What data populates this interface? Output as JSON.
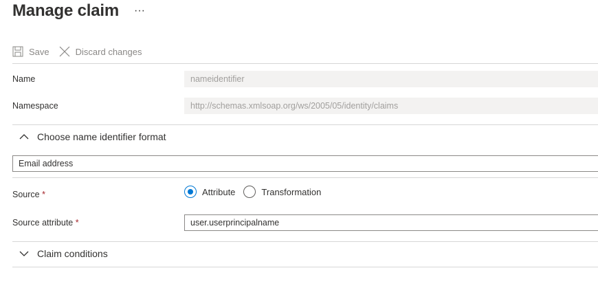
{
  "page": {
    "title": "Manage claim",
    "more": "···"
  },
  "toolbar": {
    "save_label": "Save",
    "discard_label": "Discard changes"
  },
  "form": {
    "name_label": "Name",
    "name_value": "nameidentifier",
    "namespace_label": "Namespace",
    "namespace_value": "http://schemas.xmlsoap.org/ws/2005/05/identity/claims",
    "format_section_label": "Choose name identifier format",
    "format_value": "Email address",
    "source_label": "Source",
    "required_marker": "*",
    "source_options": [
      "Attribute",
      "Transformation"
    ],
    "source_selected": "Attribute",
    "source_attribute_label": "Source attribute",
    "source_attribute_value": "user.userprincipalname",
    "claim_conditions_label": "Claim conditions"
  },
  "colors": {
    "accent": "#0078d4",
    "required": "#a4262c",
    "disabled_bg": "#f3f2f1"
  }
}
